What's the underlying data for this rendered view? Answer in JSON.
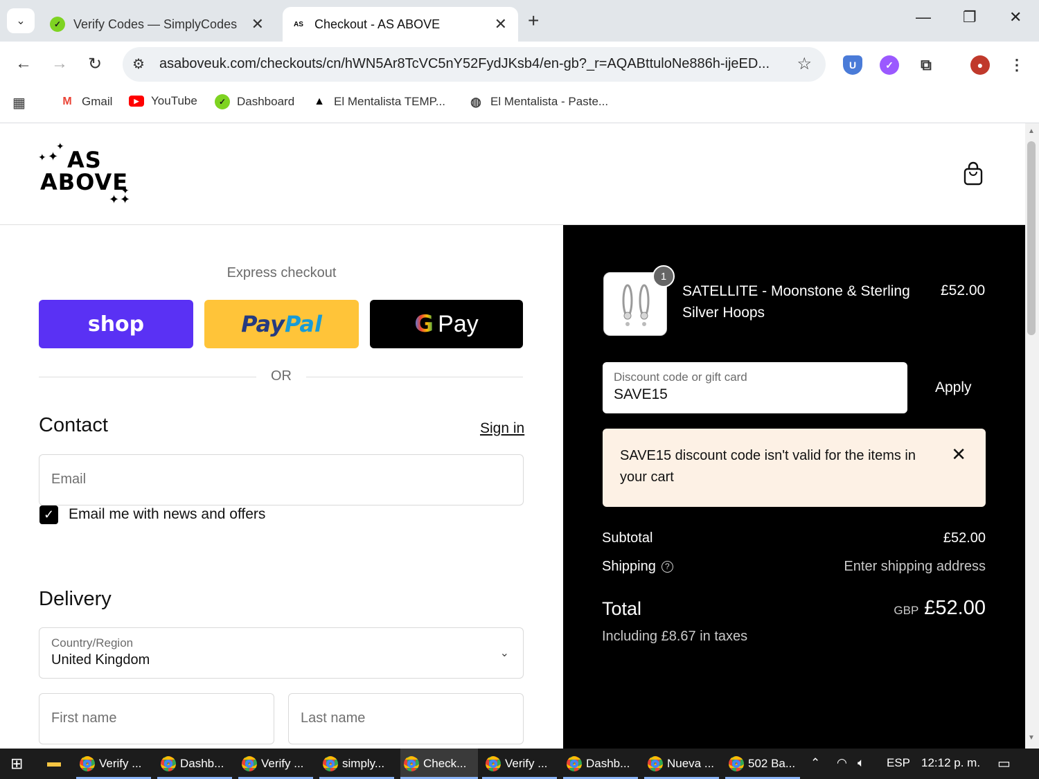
{
  "browser": {
    "tabs": [
      {
        "title": "Verify Codes — SimplyCodes",
        "active": false
      },
      {
        "title": "Checkout - AS ABOVE",
        "active": true
      }
    ],
    "url": "asaboveuk.com/checkouts/cn/hWN5Ar8TcVC5nY52FydJKsb4/en-gb?_r=AQABttuloNe886h-ijeED...",
    "bookmarks": [
      "Gmail",
      "YouTube",
      "Dashboard",
      "El Mentalista TEMP...",
      "El Mentalista - Paste..."
    ],
    "colors": {
      "tabbar": "#e2e6ea",
      "omnibox": "#eef1f4"
    }
  },
  "header": {
    "logo_line1": "AS",
    "logo_line2": "ABOVE",
    "cart_icon": "shopping-bag-icon"
  },
  "express": {
    "title": "Express checkout",
    "shop_label": "shop",
    "paypal_label_1": "Pay",
    "paypal_label_2": "Pal",
    "gpay_g": "G",
    "gpay_label": "Pay",
    "or_label": "OR",
    "colors": {
      "shop": "#5a31f4",
      "paypal": "#ffc439",
      "gpay": "#000000"
    }
  },
  "contact": {
    "title": "Contact",
    "signin_label": "Sign in",
    "email_placeholder": "Email",
    "newsletter_label": "Email me with news and offers",
    "newsletter_checked": true
  },
  "delivery": {
    "title": "Delivery",
    "country_label": "Country/Region",
    "country_value": "United Kingdom",
    "first_name_placeholder": "First name",
    "last_name_placeholder": "Last name"
  },
  "summary": {
    "item": {
      "name": "SATELLITE - Moonstone & Sterling Silver Hoops",
      "price": "£52.00",
      "quantity": "1"
    },
    "discount": {
      "label": "Discount code or gift card",
      "value": "SAVE15",
      "apply_label": "Apply"
    },
    "error_message": "SAVE15 discount code isn't valid for the items in your cart",
    "subtotal_label": "Subtotal",
    "subtotal_value": "£52.00",
    "shipping_label": "Shipping",
    "shipping_value": "Enter shipping address",
    "total_label": "Total",
    "total_currency": "GBP",
    "total_value": "£52.00",
    "tax_note": "Including £8.67 in taxes",
    "colors": {
      "panel": "#000000",
      "error_bg": "#fdf1e5"
    }
  },
  "taskbar": {
    "items": [
      "Verify ...",
      "Dashb...",
      "Verify ...",
      "simply...",
      "Check...",
      "Verify ...",
      "Dashb...",
      "Nueva ...",
      "502 Ba..."
    ],
    "active_item": "Check...",
    "language": "ESP",
    "clock": "12:12 p. m."
  }
}
